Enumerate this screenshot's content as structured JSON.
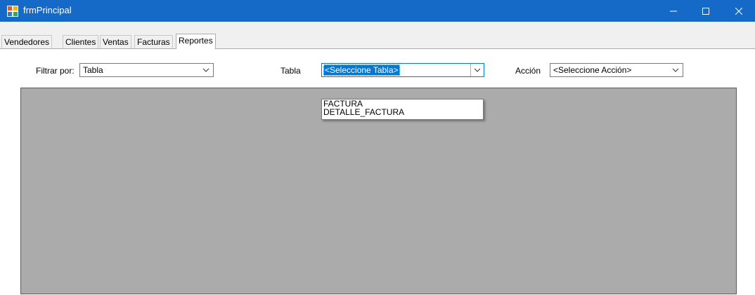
{
  "window": {
    "title": "frmPrincipal",
    "minimize_icon": "minimize-icon",
    "maximize_icon": "maximize-icon",
    "close_icon": "close-icon",
    "titlebar_color": "#1569c7"
  },
  "tabs": [
    {
      "label": "Vendedores",
      "active": false
    },
    {
      "label": "Clientes",
      "active": false
    },
    {
      "label": "Ventas",
      "active": false
    },
    {
      "label": "Facturas",
      "active": false
    },
    {
      "label": "Reportes",
      "active": true
    }
  ],
  "filters": {
    "filtrar_label": "Filtrar por:",
    "filtrar_value": "Tabla",
    "tabla_label": "Tabla",
    "tabla_value": "<Seleccione Tabla>",
    "accion_label": "Acción",
    "accion_value": "<Seleccione Acción>"
  },
  "tabla_options": [
    "FACTURA",
    "DETALLE_FACTURA"
  ],
  "colors": {
    "selection": "#0078d7",
    "grid_background": "#ababab"
  }
}
